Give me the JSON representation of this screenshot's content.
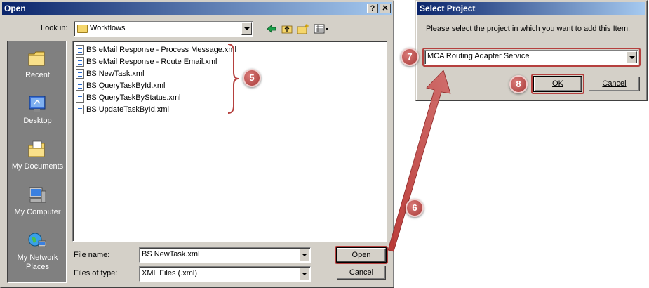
{
  "open_dialog": {
    "title": "Open",
    "help_btn": "?",
    "close_btn": "✕",
    "look_in_label": "Look in:",
    "look_in_value": "Workflows",
    "places": [
      {
        "label": "Recent"
      },
      {
        "label": "Desktop"
      },
      {
        "label": "My Documents"
      },
      {
        "label": "My Computer"
      },
      {
        "label": "My Network Places"
      }
    ],
    "files": [
      "BS eMail Response - Process Message.xml",
      "BS eMail Response - Route Email.xml",
      "BS NewTask.xml",
      "BS QueryTaskById.xml",
      "BS QueryTaskByStatus.xml",
      "BS UpdateTaskById.xml"
    ],
    "file_name_label": "File name:",
    "file_name_value": "BS NewTask.xml",
    "file_type_label": "Files of type:",
    "file_type_value": "XML Files (.xml)",
    "open_btn": "Open",
    "cancel_btn": "Cancel"
  },
  "project_dialog": {
    "title": "Select Project",
    "prompt": "Please select the project in which you want to add this Item.",
    "project_value": "MCA Routing Adapter Service",
    "ok_btn": "OK",
    "cancel_btn": "Cancel"
  },
  "annotations": {
    "m5": "5",
    "m6": "6",
    "m7": "7",
    "m8": "8"
  },
  "colors": {
    "annotation": "#b5403e",
    "title_start": "#0a246a",
    "title_end": "#a6caf0",
    "dialog_face": "#d4d0c8"
  }
}
